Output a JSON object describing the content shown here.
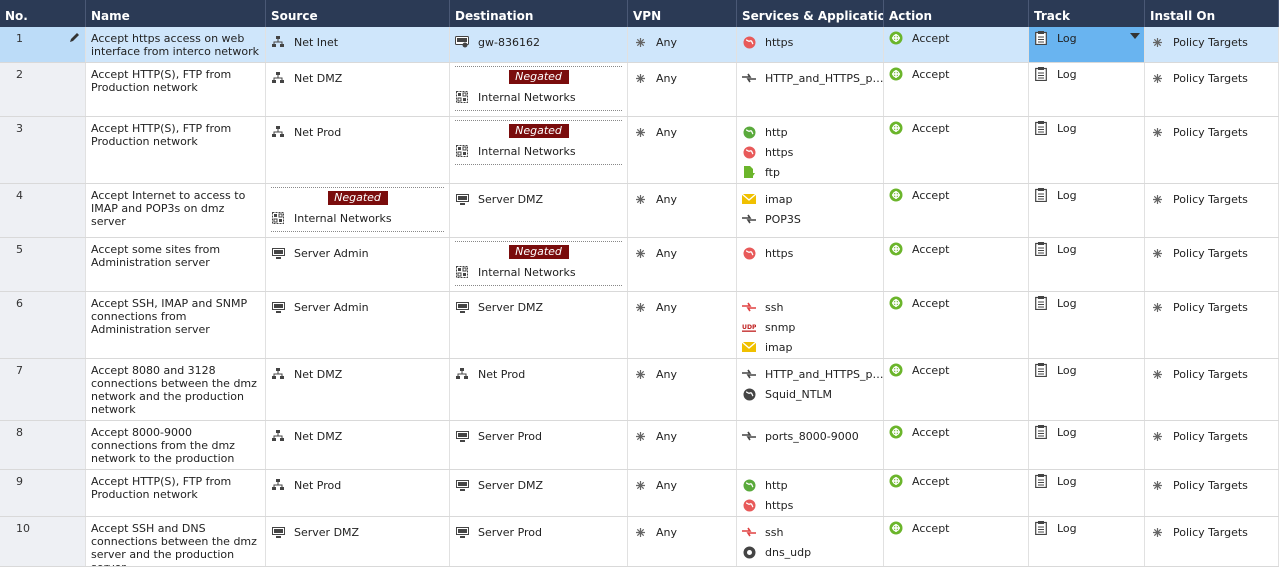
{
  "headers": [
    "No.",
    "Name",
    "Source",
    "Destination",
    "VPN",
    "Services & Applications",
    "Action",
    "Track",
    "Install On"
  ],
  "rows": [
    {
      "no": "1",
      "name": "Accept https access on web interface from interco network",
      "source": [
        {
          "icon": "network",
          "label": "Net Inet"
        }
      ],
      "source_neg": "",
      "dest": [
        {
          "icon": "gateway",
          "label": "gw-836162"
        }
      ],
      "dest_neg": "",
      "vpn": "Any",
      "services": [
        {
          "icon": "https",
          "label": "https"
        }
      ],
      "action": "Accept",
      "track": "Log",
      "install": "Policy Targets"
    },
    {
      "no": "2",
      "name": "Accept HTTP(S), FTP from Production network",
      "source": [
        {
          "icon": "network",
          "label": "Net DMZ"
        }
      ],
      "source_neg": "",
      "dest": [
        {
          "icon": "group",
          "label": "Internal Networks"
        }
      ],
      "dest_neg": "Negated",
      "vpn": "Any",
      "services": [
        {
          "icon": "group-svc",
          "label": "HTTP_and_HTTPS_p…"
        }
      ],
      "action": "Accept",
      "track": "Log",
      "install": "Policy Targets"
    },
    {
      "no": "3",
      "name": "Accept HTTP(S), FTP from Production network",
      "source": [
        {
          "icon": "network",
          "label": "Net Prod"
        }
      ],
      "source_neg": "",
      "dest": [
        {
          "icon": "group",
          "label": "Internal Networks"
        }
      ],
      "dest_neg": "Negated",
      "vpn": "Any",
      "services": [
        {
          "icon": "http",
          "label": "http"
        },
        {
          "icon": "https",
          "label": "https"
        },
        {
          "icon": "ftp",
          "label": "ftp"
        }
      ],
      "action": "Accept",
      "track": "Log",
      "install": "Policy Targets"
    },
    {
      "no": "4",
      "name": "Accept Internet to access to IMAP and POP3s on dmz server",
      "source": [
        {
          "icon": "group",
          "label": "Internal Networks"
        }
      ],
      "source_neg": "Negated",
      "dest": [
        {
          "icon": "server",
          "label": "Server DMZ"
        }
      ],
      "dest_neg": "",
      "vpn": "Any",
      "services": [
        {
          "icon": "mail",
          "label": "imap"
        },
        {
          "icon": "group-svc",
          "label": "POP3S"
        }
      ],
      "action": "Accept",
      "track": "Log",
      "install": "Policy Targets"
    },
    {
      "no": "5",
      "name": "Accept some sites from Administration server",
      "source": [
        {
          "icon": "server",
          "label": "Server Admin"
        }
      ],
      "source_neg": "",
      "dest": [
        {
          "icon": "group",
          "label": "Internal Networks"
        }
      ],
      "dest_neg": "Negated",
      "vpn": "Any",
      "services": [
        {
          "icon": "https",
          "label": "https"
        }
      ],
      "action": "Accept",
      "track": "Log",
      "install": "Policy Targets"
    },
    {
      "no": "6",
      "name": "Accept SSH, IMAP and SNMP connections from Administration server",
      "source": [
        {
          "icon": "server",
          "label": "Server Admin"
        }
      ],
      "source_neg": "",
      "dest": [
        {
          "icon": "server",
          "label": "Server DMZ"
        }
      ],
      "dest_neg": "",
      "vpn": "Any",
      "services": [
        {
          "icon": "ssh",
          "label": "ssh"
        },
        {
          "icon": "udp",
          "label": "snmp"
        },
        {
          "icon": "mail",
          "label": "imap"
        }
      ],
      "action": "Accept",
      "track": "Log",
      "install": "Policy Targets"
    },
    {
      "no": "7",
      "name": "Accept 8080 and 3128 connections between the dmz network and the production network",
      "source": [
        {
          "icon": "network",
          "label": "Net DMZ"
        }
      ],
      "source_neg": "",
      "dest": [
        {
          "icon": "network",
          "label": "Net Prod"
        }
      ],
      "dest_neg": "",
      "vpn": "Any",
      "services": [
        {
          "icon": "group-svc",
          "label": "HTTP_and_HTTPS_p…"
        },
        {
          "icon": "globe-dark",
          "label": "Squid_NTLM"
        }
      ],
      "action": "Accept",
      "track": "Log",
      "install": "Policy Targets"
    },
    {
      "no": "8",
      "name": "Accept 8000-9000 connections from the dmz network to the production server",
      "source": [
        {
          "icon": "network",
          "label": "Net DMZ"
        }
      ],
      "source_neg": "",
      "dest": [
        {
          "icon": "server",
          "label": "Server Prod"
        }
      ],
      "dest_neg": "",
      "vpn": "Any",
      "services": [
        {
          "icon": "group-svc",
          "label": "ports_8000-9000"
        }
      ],
      "action": "Accept",
      "track": "Log",
      "install": "Policy Targets"
    },
    {
      "no": "9",
      "name": "Accept HTTP(S), FTP from Production network",
      "source": [
        {
          "icon": "network",
          "label": "Net Prod"
        }
      ],
      "source_neg": "",
      "dest": [
        {
          "icon": "server",
          "label": "Server DMZ"
        }
      ],
      "dest_neg": "",
      "vpn": "Any",
      "services": [
        {
          "icon": "http",
          "label": "http"
        },
        {
          "icon": "https",
          "label": "https"
        }
      ],
      "action": "Accept",
      "track": "Log",
      "install": "Policy Targets"
    },
    {
      "no": "10",
      "name": "Accept SSH and DNS connections between the dmz server and the production server",
      "source": [
        {
          "icon": "server",
          "label": "Server DMZ"
        }
      ],
      "source_neg": "",
      "dest": [
        {
          "icon": "server",
          "label": "Server Prod"
        }
      ],
      "dest_neg": "",
      "vpn": "Any",
      "services": [
        {
          "icon": "ssh",
          "label": "ssh"
        },
        {
          "icon": "dns",
          "label": "dns_udp"
        }
      ],
      "action": "Accept",
      "track": "Log",
      "install": "Policy Targets"
    }
  ],
  "colors": {
    "header": "#2b3a55",
    "selected": "#cfe6fb",
    "accept": "#6bb52b",
    "negated": "#7a0c0c"
  }
}
